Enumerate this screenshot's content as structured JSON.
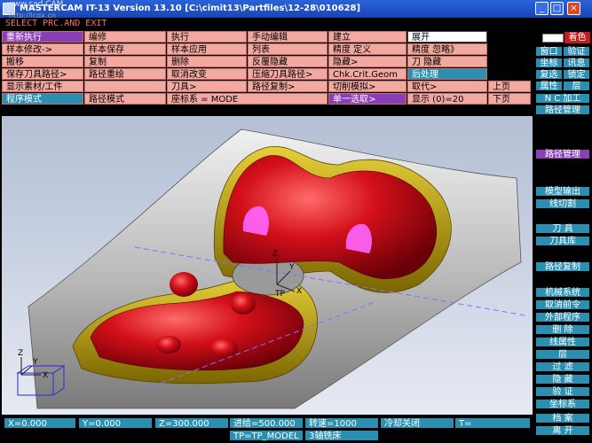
{
  "window": {
    "title": "MASTERCAM IT-13 Version 13.10 [C:\\cimit13\\Partfiles\\12-28\\010628]",
    "watermark": "www.cad CAM",
    "watermark_url": "http://jcqx.cn"
  },
  "prompt": "SELECT PRC.AND EXIT",
  "menu": {
    "row1": [
      "重新执行",
      "编修",
      "执行",
      "手动编辑",
      "建立",
      "",
      "展开"
    ],
    "row2": [
      "样本修改->",
      "样本保存",
      "样本应用",
      "列表",
      "精度 定义",
      "精度 忽略》",
      ""
    ],
    "row3": [
      "搬移",
      "复制",
      "删除",
      "反覆隐藏",
      "隐藏>",
      "刀 隐藏",
      ""
    ],
    "row4": [
      "保存刀具路径>",
      "路径重绘",
      "取消改变",
      "压缩刀具路径>",
      "Chk.Crit.Geom",
      "后处理",
      ""
    ],
    "row5": [
      "显示素材/工件",
      "",
      "刀具>",
      "路径复制>",
      "切削模拟>",
      "取代>",
      "上页"
    ],
    "row6": [
      "程序模式",
      "路径模式",
      "座标系 = MODE",
      "",
      "单一选取>",
      "显示 (0)=20",
      "下页"
    ]
  },
  "right_panel": {
    "color_label": "着色",
    "items": [
      [
        "窗口",
        "验证"
      ],
      [
        "坐标",
        "讯息"
      ],
      [
        "复选",
        "锁定"
      ],
      [
        "属性",
        "层"
      ],
      [
        "N C 加工"
      ],
      [
        "路径管理"
      ],
      [
        "路径管理"
      ],
      [
        "模型输出"
      ],
      [
        "线切割"
      ],
      [
        "刀 具"
      ],
      [
        "刀具库"
      ],
      [
        "路径复制"
      ],
      [
        "机械系统"
      ],
      [
        "取消前令"
      ],
      [
        "外部程序"
      ],
      [
        "删 除"
      ],
      [
        "线属性"
      ],
      [
        "层"
      ],
      [
        "过 滤"
      ],
      [
        "隐 藏"
      ],
      [
        "验 证"
      ],
      [
        "坐标系"
      ],
      [
        "档 案"
      ],
      [
        "离 开"
      ]
    ]
  },
  "viewport": {
    "axis_x": "X",
    "axis_y": "Y",
    "axis_z": "Z",
    "tp_label": "TP",
    "colors": {
      "part": "#d4101a",
      "stock": "#b7b7b7",
      "boss": "#c7a800",
      "highlight": "#ff66ff"
    }
  },
  "status": {
    "x": "X=0.000",
    "y": "Y=0.000",
    "z": "Z=300.000",
    "feed": "进给=500.000",
    "speed": "转速=1000",
    "coolant": "冷却关闭",
    "t": "T=",
    "tp": "TP=TP_MODEL",
    "machine": "3轴铣床"
  }
}
